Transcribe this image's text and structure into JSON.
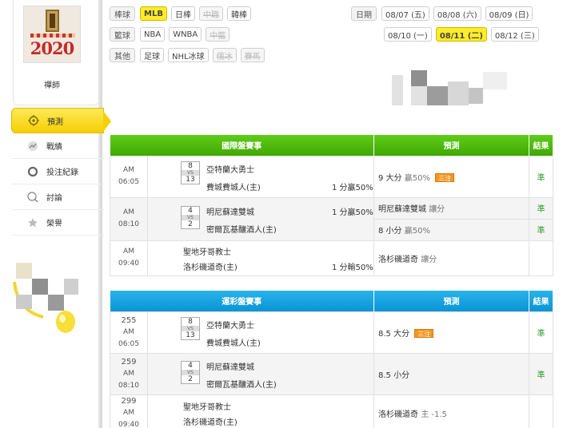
{
  "sidebar": {
    "avatar_year": "2020",
    "profile_name": "禪師",
    "menu": [
      {
        "id": "predict",
        "label": "預測",
        "icon": "target-icon",
        "active": true
      },
      {
        "id": "record",
        "label": "戰績",
        "icon": "trend-icon",
        "active": false
      },
      {
        "id": "bets",
        "label": "投注紀錄",
        "icon": "circle-icon",
        "active": false
      },
      {
        "id": "discuss",
        "label": "討論",
        "icon": "chat-icon",
        "active": false
      },
      {
        "id": "honor",
        "label": "榮譽",
        "icon": "trophy-icon",
        "active": false
      }
    ]
  },
  "filters": {
    "rows": [
      {
        "label": "棒球",
        "chips": [
          {
            "label": "MLB",
            "state": "active"
          },
          {
            "label": "日棒",
            "state": "normal"
          },
          {
            "label": "中職",
            "state": "disabled"
          },
          {
            "label": "韓棒",
            "state": "normal"
          }
        ]
      },
      {
        "label": "籃球",
        "chips": [
          {
            "label": "NBA",
            "state": "normal"
          },
          {
            "label": "WNBA",
            "state": "normal"
          },
          {
            "label": "中籃",
            "state": "disabled"
          }
        ]
      },
      {
        "label": "其他",
        "chips": [
          {
            "label": "足球",
            "state": "normal"
          },
          {
            "label": "NHL冰球",
            "state": "normal"
          },
          {
            "label": "俄冰",
            "state": "disabled"
          },
          {
            "label": "賽馬",
            "state": "disabled"
          }
        ]
      }
    ]
  },
  "dates": {
    "label": "日期",
    "row1": [
      {
        "label": "08/07 (五)",
        "active": false
      },
      {
        "label": "08/08 (六)",
        "active": false
      },
      {
        "label": "08/09 (日)",
        "active": false
      }
    ],
    "row2": [
      {
        "label": "08/10 (一)",
        "active": false
      },
      {
        "label": "08/11 (二)",
        "active": true
      },
      {
        "label": "08/12 (三)",
        "active": false
      }
    ]
  },
  "intl_table": {
    "headers": [
      "國際盤賽事",
      "預測",
      "結果"
    ],
    "rows": [
      {
        "time": "AM 06:05",
        "score_away": "8",
        "score_home": "13",
        "away": "亞特蘭大勇士",
        "home": "費城費城人(主)",
        "handicap": "1 分贏50%",
        "handicap_row": "home",
        "preds": [
          {
            "text": "9 大分",
            "note": "贏50%",
            "tag": "三注",
            "result": "準"
          }
        ]
      },
      {
        "time": "AM 08:10",
        "score_away": "4",
        "score_home": "2",
        "away": "明尼蘇達雙城",
        "home": "密爾瓦基釀酒人(主)",
        "handicap": "1 分贏50%",
        "handicap_row": "away",
        "preds": [
          {
            "text": "明尼蘇達雙城",
            "note": "讓分",
            "tag": "",
            "result": "準"
          },
          {
            "text": "8 小分",
            "note": "贏50%",
            "tag": "",
            "result": "準"
          }
        ]
      },
      {
        "time": "AM 09:40",
        "score_away": "",
        "score_home": "",
        "away": "聖地牙哥教士",
        "home": "洛杉磯道奇(主)",
        "handicap": "1 分輸50%",
        "handicap_row": "home",
        "preds": [
          {
            "text": "洛杉磯道奇",
            "note": "讓分",
            "tag": "",
            "result": ""
          }
        ]
      }
    ]
  },
  "lottery_table": {
    "headers": [
      "運彩盤賽事",
      "預測",
      "結果"
    ],
    "rows": [
      {
        "no": "255",
        "time": "AM 06:05",
        "score_away": "8",
        "score_home": "13",
        "away": "亞特蘭大勇士",
        "home": "費城費城人(主)",
        "pred": "8.5 大分",
        "note": "",
        "tag": "三注",
        "result": "準"
      },
      {
        "no": "259",
        "time": "AM 08:10",
        "score_away": "4",
        "score_home": "2",
        "away": "明尼蘇達雙城",
        "home": "密爾瓦基釀酒人(主)",
        "pred": "8.5 小分",
        "note": "",
        "tag": "",
        "result": "準"
      },
      {
        "no": "299",
        "time": "AM 09:40",
        "score_away": "",
        "score_home": "",
        "away": "聖地牙哥教士",
        "home": "洛杉磯道奇(主)",
        "pred": "洛杉磯道奇",
        "note": "主 -1.5",
        "tag": "",
        "result": ""
      }
    ]
  },
  "vs_label": "VS",
  "colors": {
    "accent_yellow": "#ffec2b",
    "intl_header": "#3fa800",
    "lottery_header": "#0a94d6",
    "result_green": "#2e9e2e",
    "tag_orange": "#f19722"
  }
}
